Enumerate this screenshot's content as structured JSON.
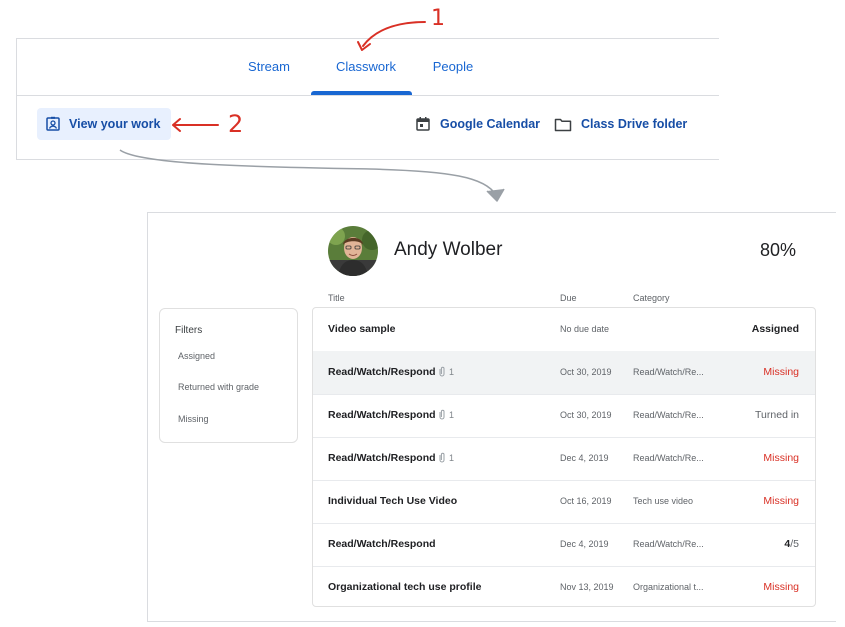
{
  "tabs": [
    {
      "label": "Stream",
      "active": false
    },
    {
      "label": "Classwork",
      "active": true
    },
    {
      "label": "People",
      "active": false
    }
  ],
  "toolbar": {
    "view_work": "View your work",
    "calendar": "Google Calendar",
    "drive": "Class Drive folder"
  },
  "annotations": {
    "one": "1",
    "two": "2"
  },
  "student": {
    "name": "Andy Wolber",
    "grade_percent": "80%"
  },
  "filters": {
    "title": "Filters",
    "items": [
      "Assigned",
      "Returned with grade",
      "Missing"
    ]
  },
  "columns": {
    "title": "Title",
    "due": "Due",
    "category": "Category"
  },
  "rows": [
    {
      "title": "Video sample",
      "attachments": "",
      "due": "No due date",
      "category": "",
      "status": "Assigned"
    },
    {
      "title": "Read/Watch/Respond",
      "attachments": "1",
      "due": "Oct 30, 2019",
      "category": "Read/Watch/Re...",
      "status": "Missing"
    },
    {
      "title": "Read/Watch/Respond",
      "attachments": "1",
      "due": "Oct 30, 2019",
      "category": "Read/Watch/Re...",
      "status": "Turned in"
    },
    {
      "title": "Read/Watch/Respond",
      "attachments": "1",
      "due": "Dec 4, 2019",
      "category": "Read/Watch/Re...",
      "status": "Missing"
    },
    {
      "title": "Individual Tech Use Video",
      "attachments": "",
      "due": "Oct 16, 2019",
      "category": "Tech use video",
      "status": "Missing"
    },
    {
      "title": "Read/Watch/Respond",
      "attachments": "",
      "due": "Dec 4, 2019",
      "category": "Read/Watch/Re...",
      "status_grade": "4",
      "status_total": "/5"
    },
    {
      "title": "Organizational tech use profile",
      "attachments": "",
      "due": "Nov 13, 2019",
      "category": "Organizational t...",
      "status": "Missing"
    }
  ],
  "colors": {
    "accent": "#1967d2",
    "missing": "#d93025",
    "annotation": "#d93025"
  }
}
